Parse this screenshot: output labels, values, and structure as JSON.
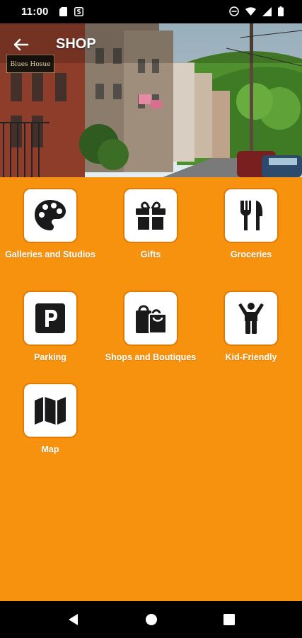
{
  "status_bar": {
    "time": "11:00",
    "left_icons": [
      "sd-card-icon",
      "s-notification-icon"
    ],
    "right_icons": [
      "do-not-disturb-icon",
      "wifi-icon",
      "signal-icon",
      "battery-icon"
    ]
  },
  "app_bar": {
    "title": "SHOP",
    "back_icon": "arrow-back-icon"
  },
  "hero": {
    "sign_text": "Blues Hosue"
  },
  "categories": [
    {
      "label": "Galleries and Studios",
      "icon": "palette-icon"
    },
    {
      "label": "Gifts",
      "icon": "gift-icon"
    },
    {
      "label": "Groceries",
      "icon": "fork-knife-icon"
    },
    {
      "label": "Parking",
      "icon": "parking-icon"
    },
    {
      "label": "Shops and Boutiques",
      "icon": "shopping-bags-icon"
    },
    {
      "label": "Kid-Friendly",
      "icon": "child-icon"
    },
    {
      "label": "Map",
      "icon": "map-icon"
    }
  ],
  "colors": {
    "background": "#f7920f",
    "tile": "#ffffff",
    "tile_border": "#e07a05",
    "icon": "#1a1a1a"
  },
  "nav_bar": {
    "buttons": [
      "back-triangle-icon",
      "home-circle-icon",
      "recents-square-icon"
    ]
  }
}
